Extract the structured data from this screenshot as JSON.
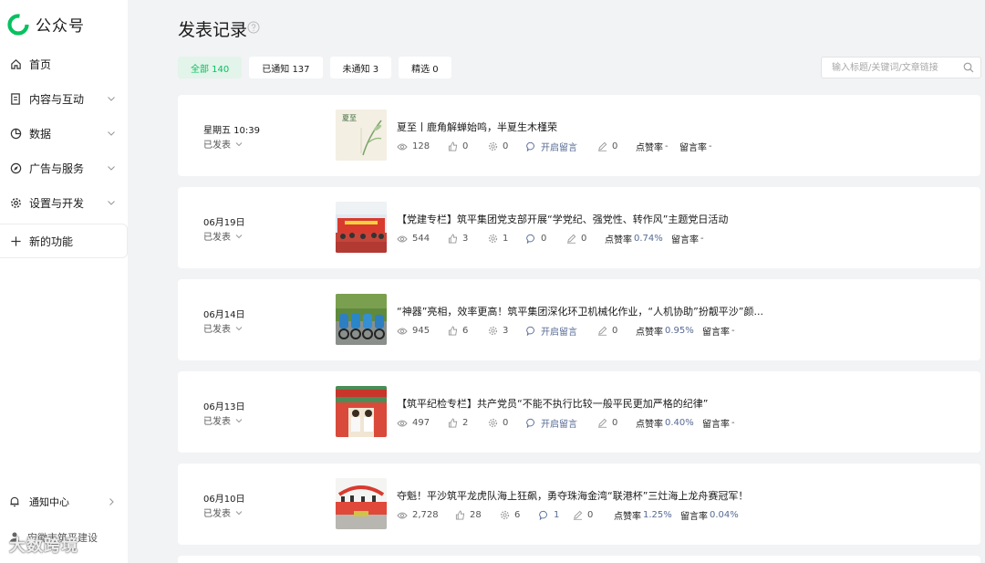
{
  "app": {
    "name": "公众号"
  },
  "nav": {
    "home": "首页",
    "content": "内容与互动",
    "data": "数据",
    "ads": "广告与服务",
    "settings": "设置与开发",
    "new": "新的功能",
    "notifications": "通知中心",
    "account": "安徽市筑平建设"
  },
  "watermark": "大数跨境",
  "header": {
    "title": "发表记录"
  },
  "tabs": [
    {
      "label": "全部 140"
    },
    {
      "label": "已通知 137"
    },
    {
      "label": "未通知 3"
    },
    {
      "label": "精选 0"
    }
  ],
  "search": {
    "placeholder": "输入标题/关键词/文章链接"
  },
  "stat_labels": {
    "like_rate": "点赞率",
    "comment_rate": "留言率"
  },
  "articles": [
    {
      "date": "星期五 10:39",
      "status": "已发表",
      "title": "夏至丨鹿角解蝉始鸣，半夏生木槿荣",
      "thumb_text": "夏至",
      "views": "128",
      "likes": "0",
      "shares": "0",
      "comments": "开启留言",
      "comments_link": true,
      "edits": "0",
      "like_rate": "-",
      "comment_rate": "-"
    },
    {
      "date": "06月19日",
      "status": "已发表",
      "title": "【党建专栏】筑平集团党支部开展“学党纪、强党性、转作风”主题党日活动",
      "views": "544",
      "likes": "3",
      "shares": "1",
      "comments": "0",
      "comments_link": false,
      "edits": "0",
      "like_rate": "0.74%",
      "comment_rate": "-"
    },
    {
      "date": "06月14日",
      "status": "已发表",
      "title": "“神器”亮相，效率更高！筑平集团深化环卫机械化作业，“人机协助”扮靓平沙”颜...",
      "views": "945",
      "likes": "6",
      "shares": "3",
      "comments": "开启留言",
      "comments_link": true,
      "edits": "0",
      "like_rate": "0.95%",
      "comment_rate": "-"
    },
    {
      "date": "06月13日",
      "status": "已发表",
      "title": "【筑平纪检专栏】共产党员“不能不执行比较一般平民更加严格的纪律”",
      "views": "497",
      "likes": "2",
      "shares": "0",
      "comments": "开启留言",
      "comments_link": true,
      "edits": "0",
      "like_rate": "0.40%",
      "comment_rate": "-"
    },
    {
      "date": "06月10日",
      "status": "已发表",
      "title": "夺魁！平沙筑平龙虎队海上狂飙，勇夺珠海金湾“联港杯”三灶海上龙舟赛冠军！",
      "views": "2,728",
      "likes": "28",
      "shares": "6",
      "comments": "1",
      "comments_link": false,
      "edits": "0",
      "like_rate": "1.25%",
      "comment_rate": "0.04%"
    }
  ],
  "colors": {
    "accent": "#07c160",
    "link": "#576b95",
    "background": "#f2f3f5"
  }
}
